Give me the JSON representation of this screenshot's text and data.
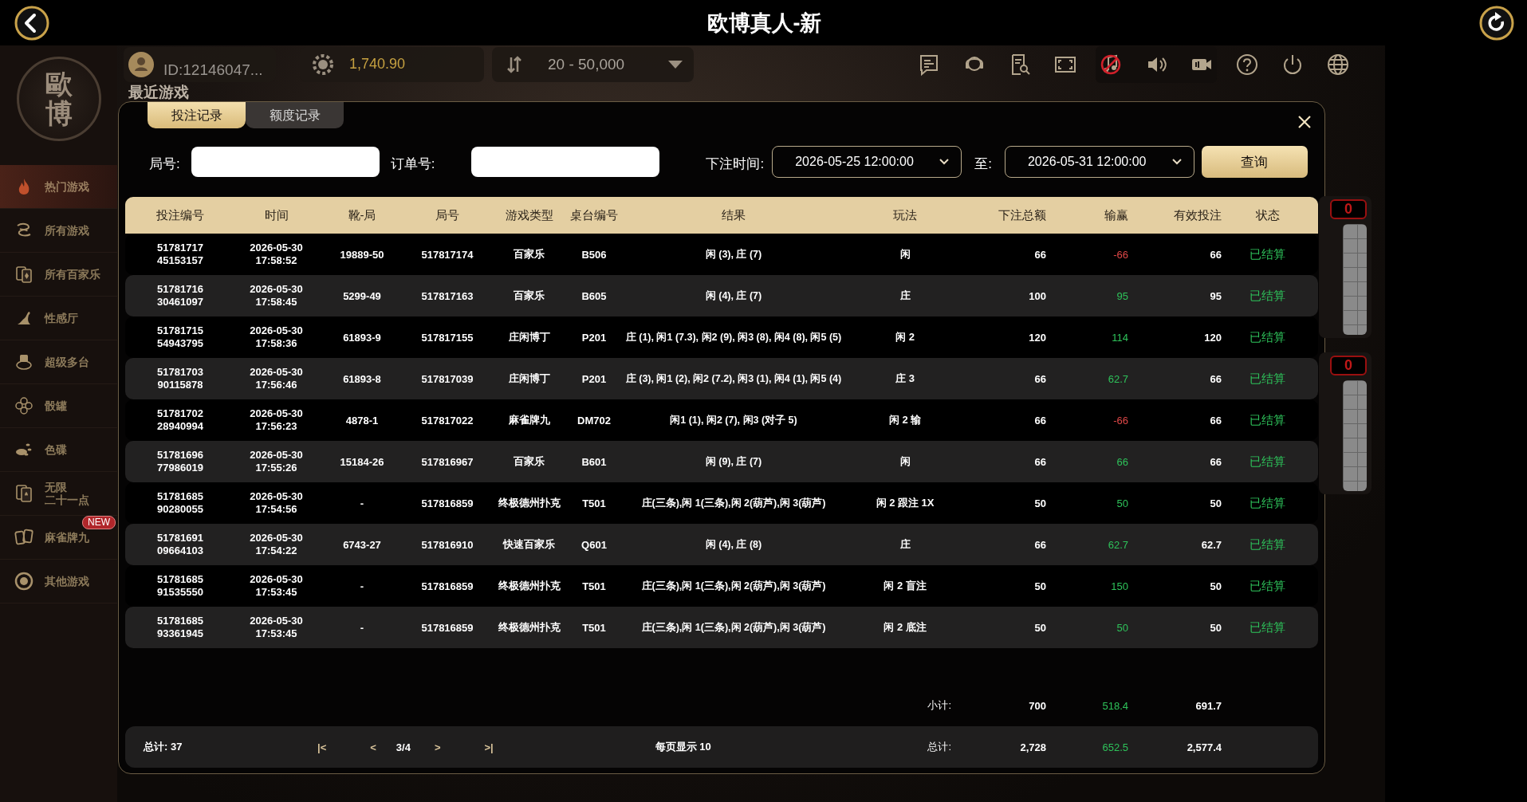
{
  "window": {
    "title": "欧博真人-新"
  },
  "sidebar": {
    "logo": "歐博",
    "items": [
      {
        "label": "热门游戏",
        "selected": true
      },
      {
        "label": "所有游戏",
        "selected": false
      },
      {
        "label": "所有百家乐",
        "selected": false
      },
      {
        "label": "性感厅",
        "selected": false
      },
      {
        "label": "超级多台",
        "selected": false
      },
      {
        "label": "骰罐",
        "selected": false
      },
      {
        "label": "色碟",
        "selected": false
      },
      {
        "label": [
          "无限",
          "二十一点"
        ],
        "selected": false
      },
      {
        "label": "麻雀牌九",
        "selected": false,
        "badge": "NEW"
      },
      {
        "label": "其他游戏",
        "selected": false
      }
    ]
  },
  "toolbar": {
    "user_id": "ID:12146047...",
    "balance": "1,740.90",
    "bet_limit": "20 - 50,000",
    "music_muted": true
  },
  "section_title": "最近游戏",
  "side_panels": [
    {
      "counter": "0"
    },
    {
      "counter": "0"
    }
  ],
  "dialog": {
    "tabs": [
      {
        "label": "投注记录",
        "selected": true
      },
      {
        "label": "额度记录",
        "selected": false
      }
    ],
    "filters": [
      {
        "kind": "text",
        "label": "局号:"
      },
      {
        "kind": "text",
        "label": "订单号:"
      },
      {
        "kind": "select",
        "label": "下注时间:",
        "value": "2026-05-25 12:00:00"
      },
      {
        "kind": "select",
        "label": "至:",
        "value": "2026-05-31 12:00:00"
      }
    ],
    "search_button": "查询",
    "table": {
      "columns": [
        "投注编号",
        "时间",
        "靴-局",
        "局号",
        "游戏类型",
        "桌台编号",
        "结果",
        "玩法",
        "下注总额",
        "输赢",
        "有效投注",
        "状态"
      ],
      "rows": [
        {
          "cells": [
            "5178171745153157",
            "2026-05-30 17:58:52",
            "19889-50",
            "517817174",
            "百家乐",
            "B506",
            "闲 (3), 庄 (7)",
            "闲",
            "66",
            "-66",
            "66",
            "已结算"
          ],
          "win": false
        },
        {
          "cells": [
            "5178171630461097",
            "2026-05-30 17:58:45",
            "5299-49",
            "517817163",
            "百家乐",
            "B605",
            "闲 (4), 庄 (7)",
            "庄",
            "100",
            "95",
            "95",
            "已结算"
          ],
          "win": true
        },
        {
          "cells": [
            "5178171554943795",
            "2026-05-30 17:58:36",
            "61893-9",
            "517817155",
            "庄闲博丁",
            "P201",
            "庄 (1), 闲1 (7.3), 闲2 (9), 闲3 (8), 闲4 (8), 闲5 (5)",
            "闲 2",
            "120",
            "114",
            "120",
            "已结算"
          ],
          "win": true
        },
        {
          "cells": [
            "5178170390115878",
            "2026-05-30 17:56:46",
            "61893-8",
            "517817039",
            "庄闲博丁",
            "P201",
            "庄 (3), 闲1 (2), 闲2 (7.2), 闲3 (1), 闲4 (1), 闲5 (4)",
            "庄 3",
            "66",
            "62.7",
            "66",
            "已结算"
          ],
          "win": true
        },
        {
          "cells": [
            "5178170228940994",
            "2026-05-30 17:56:23",
            "4878-1",
            "517817022",
            "麻雀牌九",
            "DM702",
            "闲1 (1), 闲2 (7), 闲3 (对子 5)",
            "闲 2 输",
            "66",
            "-66",
            "66",
            "已结算"
          ],
          "win": false
        },
        {
          "cells": [
            "5178169677986019",
            "2026-05-30 17:55:26",
            "15184-26",
            "517816967",
            "百家乐",
            "B601",
            "闲 (9), 庄 (7)",
            "闲",
            "66",
            "66",
            "66",
            "已结算"
          ],
          "win": true
        },
        {
          "cells": [
            "5178168590280055",
            "2026-05-30 17:54:56",
            "-",
            "517816859",
            "终极德州扑克",
            "T501",
            "庄(三条),闲 1(三条),闲 2(葫芦),闲 3(葫芦)",
            "闲 2 跟注 1X",
            "50",
            "50",
            "50",
            "已结算"
          ],
          "win": true
        },
        {
          "cells": [
            "5178169109664103",
            "2026-05-30 17:54:22",
            "6743-27",
            "517816910",
            "快速百家乐",
            "Q601",
            "闲 (4), 庄 (8)",
            "庄",
            "66",
            "62.7",
            "62.7",
            "已结算"
          ],
          "win": true
        },
        {
          "cells": [
            "5178168591535550",
            "2026-05-30 17:53:45",
            "-",
            "517816859",
            "终极德州扑克",
            "T501",
            "庄(三条),闲 1(三条),闲 2(葫芦),闲 3(葫芦)",
            "闲 2 盲注",
            "50",
            "150",
            "50",
            "已结算"
          ],
          "win": true
        },
        {
          "cells": [
            "5178168593361945",
            "2026-05-30 17:53:45",
            "-",
            "517816859",
            "终极德州扑克",
            "T501",
            "庄(三条),闲 1(三条),闲 2(葫芦),闲 3(葫芦)",
            "闲 2 底注",
            "50",
            "50",
            "50",
            "已结算"
          ],
          "win": true
        }
      ],
      "subtotal": {
        "label": "小计:",
        "bet_amount": "700",
        "win_loss": "518.4",
        "valid_bet": "691.7",
        "win": true
      }
    },
    "footer": {
      "total_count": "总计:  37",
      "pagination": {
        "first": "|<",
        "prev": "<",
        "page": "3/4",
        "next": ">",
        "last": ">|"
      },
      "per_page": "每页显示  10",
      "total_label": "总计:",
      "bet_amount": "2,728",
      "win_loss": "652.5",
      "valid_bet": "2,577.4",
      "win": true
    }
  }
}
